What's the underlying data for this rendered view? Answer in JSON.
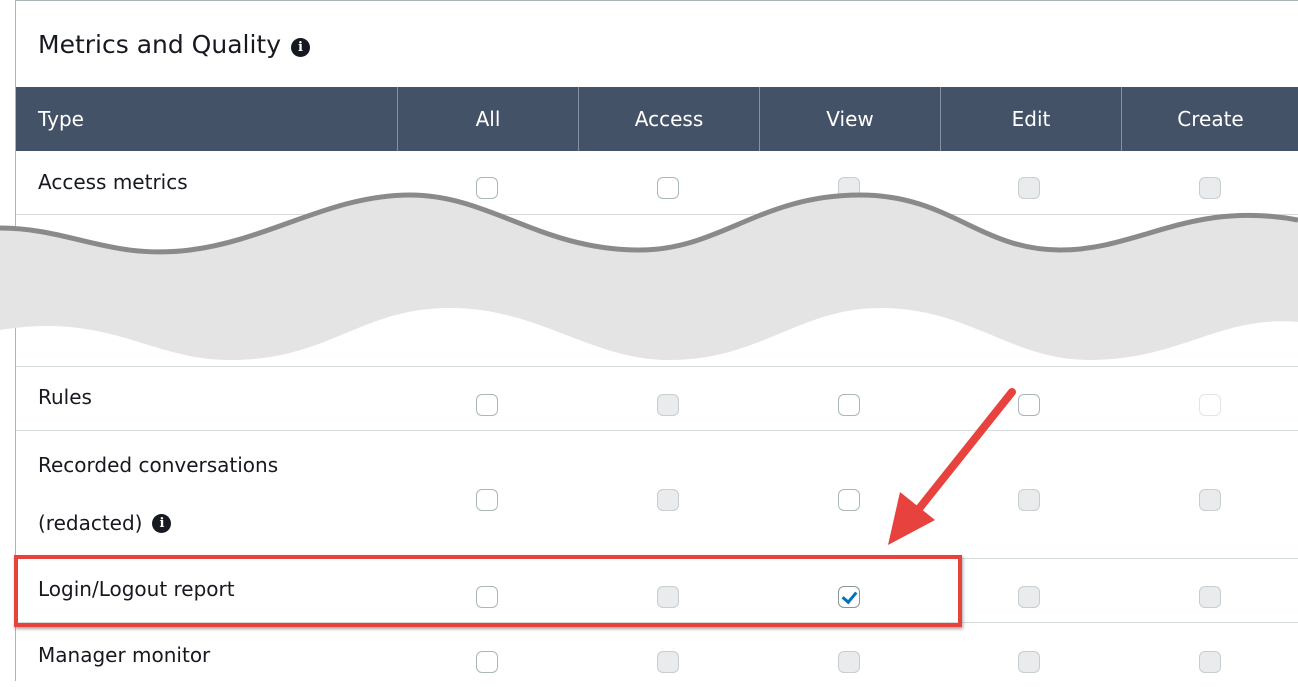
{
  "section": {
    "title": "Metrics and Quality",
    "info_icon": "info-icon"
  },
  "columns": {
    "type": "Type",
    "all": "All",
    "access": "Access",
    "view": "View",
    "edit": "Edit",
    "create": "Create"
  },
  "rows": [
    {
      "label": "Access metrics",
      "checkboxes": {
        "all": {
          "checked": false,
          "disabled": false
        },
        "access": {
          "checked": false,
          "disabled": false
        },
        "view": {
          "checked": false,
          "disabled": true
        },
        "edit": {
          "checked": false,
          "disabled": true
        },
        "create": {
          "checked": false,
          "disabled": true
        }
      }
    },
    {
      "label": "Rules",
      "checkboxes": {
        "all": {
          "checked": false,
          "disabled": false
        },
        "access": {
          "checked": false,
          "disabled": true
        },
        "view": {
          "checked": false,
          "disabled": false
        },
        "edit": {
          "checked": false,
          "disabled": false
        },
        "create": {
          "checked": false,
          "disabled": false
        }
      }
    },
    {
      "label_line1": "Recorded conversations",
      "label_line2": "(redacted)",
      "checkboxes": {
        "all": {
          "checked": false,
          "disabled": false
        },
        "access": {
          "checked": false,
          "disabled": true
        },
        "view": {
          "checked": false,
          "disabled": false
        },
        "edit": {
          "checked": false,
          "disabled": true
        },
        "create": {
          "checked": false,
          "disabled": true
        }
      }
    },
    {
      "label": "Login/Logout report",
      "highlighted": true,
      "checkboxes": {
        "all": {
          "checked": false,
          "disabled": false
        },
        "access": {
          "checked": false,
          "disabled": true
        },
        "view": {
          "checked": true,
          "disabled": false
        },
        "edit": {
          "checked": false,
          "disabled": true
        },
        "create": {
          "checked": false,
          "disabled": true
        }
      }
    },
    {
      "label": "Manager monitor",
      "checkboxes": {
        "all": {
          "checked": false,
          "disabled": false
        },
        "access": {
          "checked": false,
          "disabled": true
        },
        "view": {
          "checked": false,
          "disabled": true
        },
        "edit": {
          "checked": false,
          "disabled": true
        },
        "create": {
          "checked": false,
          "disabled": true
        }
      }
    }
  ],
  "annotation": {
    "highlight_color": "#e8423f",
    "arrow_color": "#e8423f"
  },
  "colors": {
    "header_bg": "#445267",
    "check_color": "#0073bb"
  }
}
